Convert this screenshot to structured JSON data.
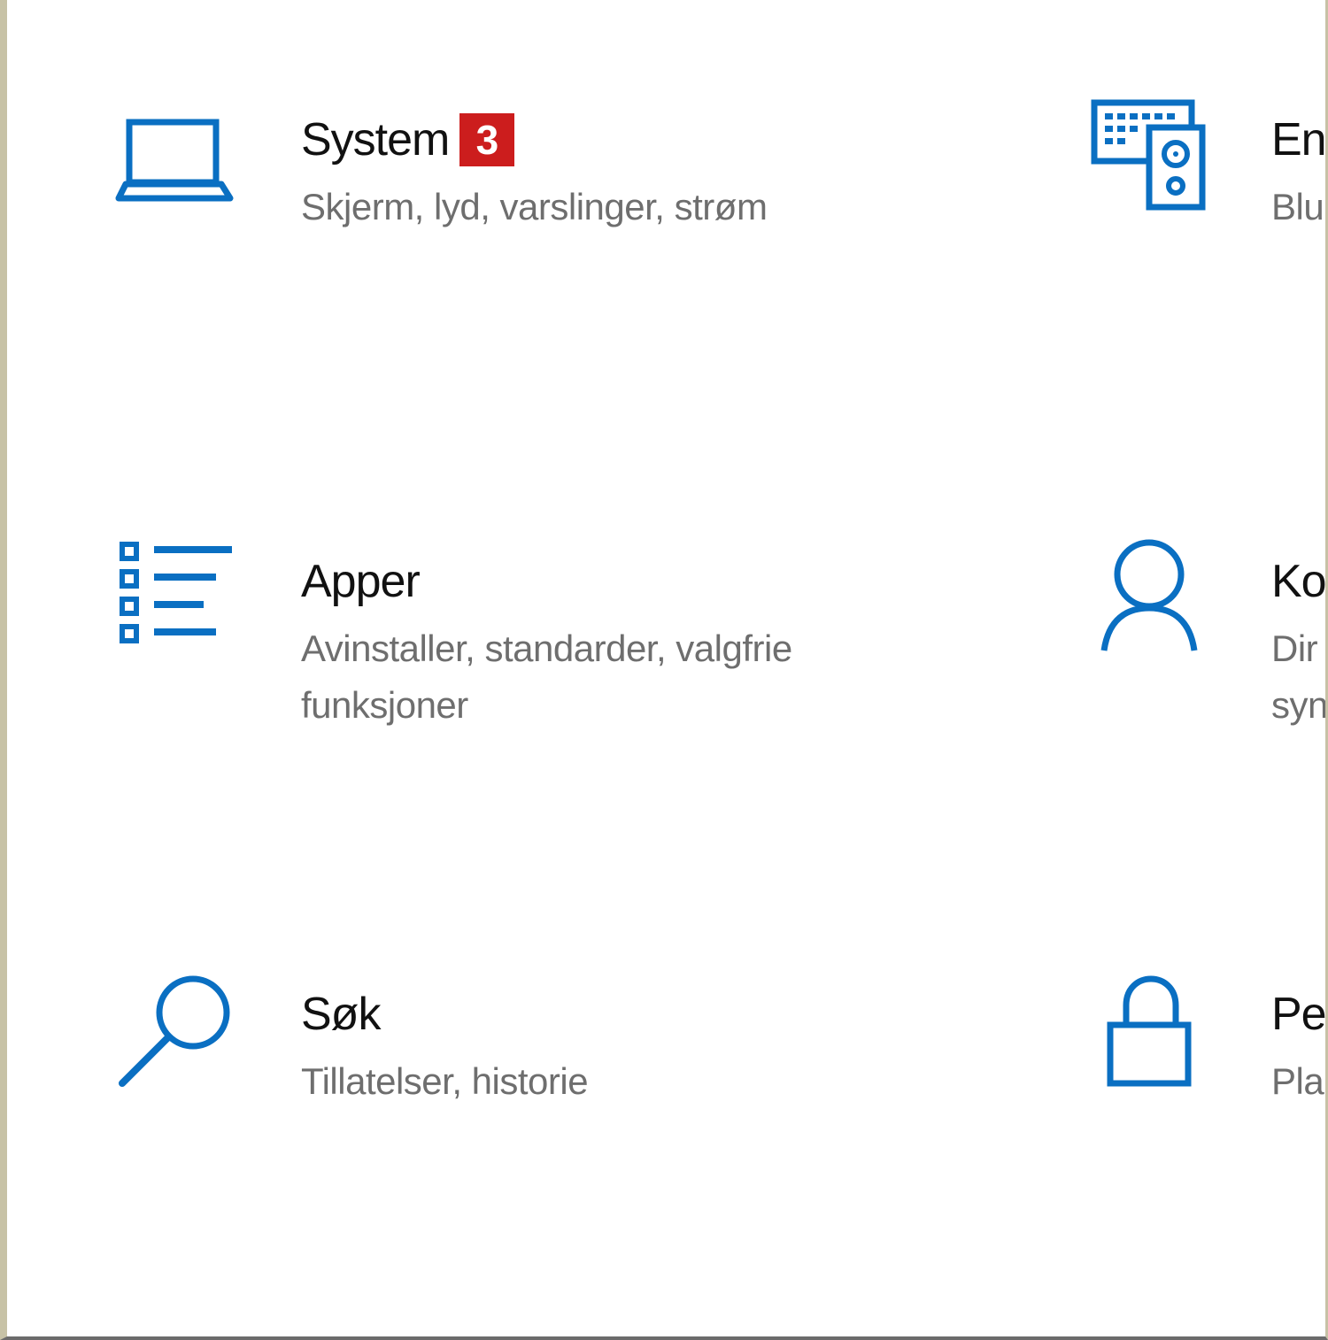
{
  "colors": {
    "accent": "#0a6fc2",
    "badge_bg": "#cc1d1d",
    "title": "#111111",
    "desc": "#6e6e6e"
  },
  "tiles": [
    {
      "id": "system",
      "icon": "laptop-icon",
      "title": "System",
      "badge": "3",
      "desc": "Skjerm, lyd, varslinger, strøm"
    },
    {
      "id": "devices",
      "icon": "keyboard-speaker-icon",
      "title": "Enh",
      "desc": "Blu"
    },
    {
      "id": "apps",
      "icon": "app-list-icon",
      "title": "Apper",
      "desc": "Avinstaller, standarder, valgfrie funksjoner"
    },
    {
      "id": "accounts",
      "icon": "person-icon",
      "title": "Ko",
      "desc_line1": "Dir",
      "desc_line2": "syn"
    },
    {
      "id": "search",
      "icon": "search-icon",
      "title": "Søk",
      "desc": "Tillatelser, historie"
    },
    {
      "id": "privacy",
      "icon": "lock-icon",
      "title": "Per",
      "desc": "Pla"
    }
  ]
}
